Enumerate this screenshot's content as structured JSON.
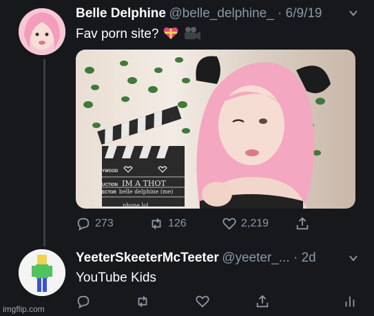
{
  "tweet1": {
    "display_name": "Belle Delphine",
    "handle_date": "@belle_delphine_ · 6/9/19",
    "text": "Fav porn site?",
    "emoji": [
      "heart-gift-emoji",
      "movie-camera-emoji"
    ],
    "media": {
      "clapper_lines": [
        "YWOOD",
        "UCTION",
        "ECTOR"
      ],
      "clapper_writing": [
        "IM A THOT",
        "belle delphine (me)",
        "phone lol"
      ]
    },
    "actions": {
      "replies": "273",
      "retweets": "126",
      "likes": "2,219"
    }
  },
  "tweet2": {
    "display_name": "YeeterSkeeterMcTeeter",
    "handle_date": "@yeeter_... · 2d",
    "text": "YouTube Kids"
  },
  "watermark": "imgflip.com",
  "colors": {
    "background": "#16181c",
    "text": "#e7e9ea",
    "muted": "#8b98a5",
    "pink_hair": "#f4a7c0"
  }
}
